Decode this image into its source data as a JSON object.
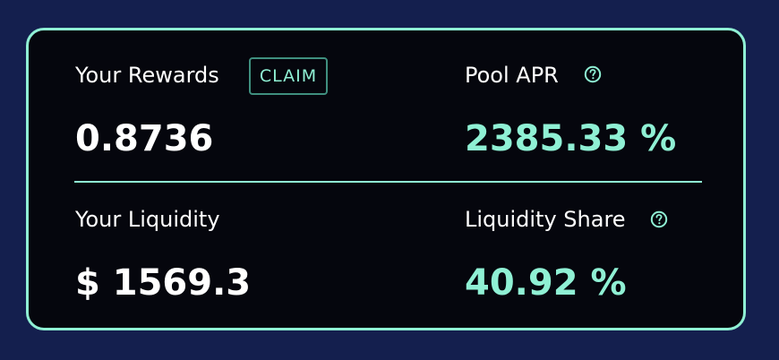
{
  "rewards": {
    "label": "Your Rewards",
    "claim_label": "CLAIM",
    "value": "0.8736"
  },
  "pool_apr": {
    "label": "Pool APR",
    "value": "2385.33 %",
    "help_icon": "question-circle-icon"
  },
  "liquidity": {
    "label": "Your Liquidity",
    "value": "$ 1569.3"
  },
  "liquidity_share": {
    "label": "Liquidity Share",
    "value": "40.92 %",
    "help_icon": "question-circle-icon"
  },
  "colors": {
    "background": "#141f4e",
    "card": "#05060d",
    "accent": "#8ff0d4",
    "text": "#ffffff"
  }
}
